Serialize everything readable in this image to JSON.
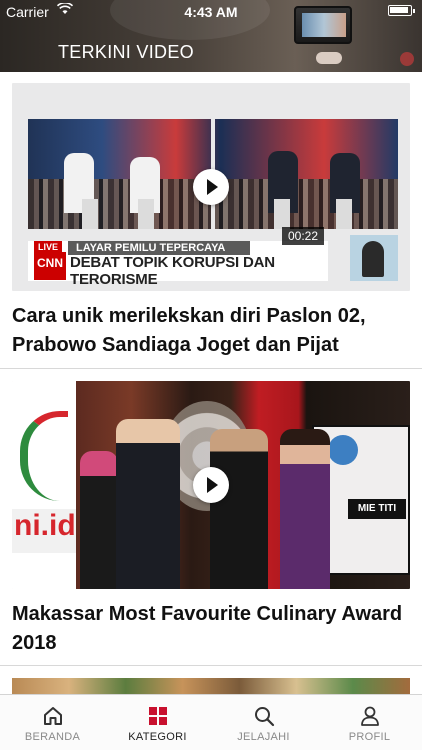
{
  "status_bar": {
    "carrier": "Carrier",
    "time": "4:43 AM"
  },
  "header": {
    "title": "TERKINI VIDEO"
  },
  "videos": [
    {
      "title": "Cara unik merilekskan diri Paslon 02, Prabowo Sandiaga Joget dan Pijat",
      "duration": "00:22",
      "overlay": {
        "live": "LIVE",
        "tag": "LAYAR PEMILU TEPERCAYA",
        "network": "CNN",
        "headline": "DEBAT TOPIK KORUPSI DAN TERORISME"
      }
    },
    {
      "title": "Makassar Most Favourite Culinary Award 2018",
      "overlay": {
        "banner": "ni.id",
        "screen_label": "MIE TITI"
      }
    }
  ],
  "tabbar": {
    "items": [
      {
        "label": "BERANDA",
        "icon": "home-icon",
        "active": false
      },
      {
        "label": "KATEGORI",
        "icon": "grid-icon",
        "active": true
      },
      {
        "label": "JELAJAHI",
        "icon": "search-icon",
        "active": false
      },
      {
        "label": "PROFIL",
        "icon": "person-icon",
        "active": false
      }
    ],
    "active_color": "#c8102e"
  }
}
